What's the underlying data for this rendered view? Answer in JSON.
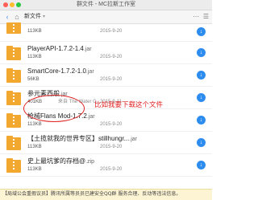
{
  "window": {
    "title": "群文件 - MC拉斯工作室"
  },
  "toolbar": {
    "back_label": "‹",
    "home_label": "⌂",
    "breadcrumb": "新文件",
    "breadcrumb_sep": "▾",
    "more_label": "⋯",
    "view_label": "☰"
  },
  "files": [
    {
      "name": "",
      "ext": "",
      "size": "113KB",
      "source": "",
      "date": "2015-9-20",
      "download_label": "↓"
    },
    {
      "name": "PlayerAPI-1.7.2-1.4",
      "ext": ".jar",
      "size": "113KB",
      "source": "",
      "date": "2015-9-20",
      "download_label": "↓"
    },
    {
      "name": "SmartCore-1.7.2-1.0",
      "ext": ".jar",
      "size": "56KB",
      "source": "",
      "date": "2015-9-20",
      "download_label": "↓"
    },
    {
      "name": "参元素西般",
      "ext": ".jar",
      "size": "401KB",
      "source": "来自 The Water G...",
      "date": "2015-9-11",
      "download_label": "↓"
    },
    {
      "name": "枪械Flans Mod-1.7.2",
      "ext": ".jar",
      "size": "113KB",
      "source": "",
      "date": "2015-9-20",
      "download_label": "↓"
    },
    {
      "name": "【土揽就我的世界专区】stillhungr...",
      "ext": ".jar",
      "size": "113KB",
      "source": "",
      "date": "2015-9-20",
      "download_label": "↓"
    },
    {
      "name": "史上最坑爹的存档@",
      "ext": ".zip",
      "size": "113KB",
      "source": "",
      "date": "2015-9-20",
      "download_label": "↓"
    }
  ],
  "annotation": {
    "text": "比如我要下载这个文件"
  },
  "footer": {
    "notice": "【局域公会重假议员】腾讯所属等员员已建安全QQ群 服务合理、反动等违法信息。"
  }
}
